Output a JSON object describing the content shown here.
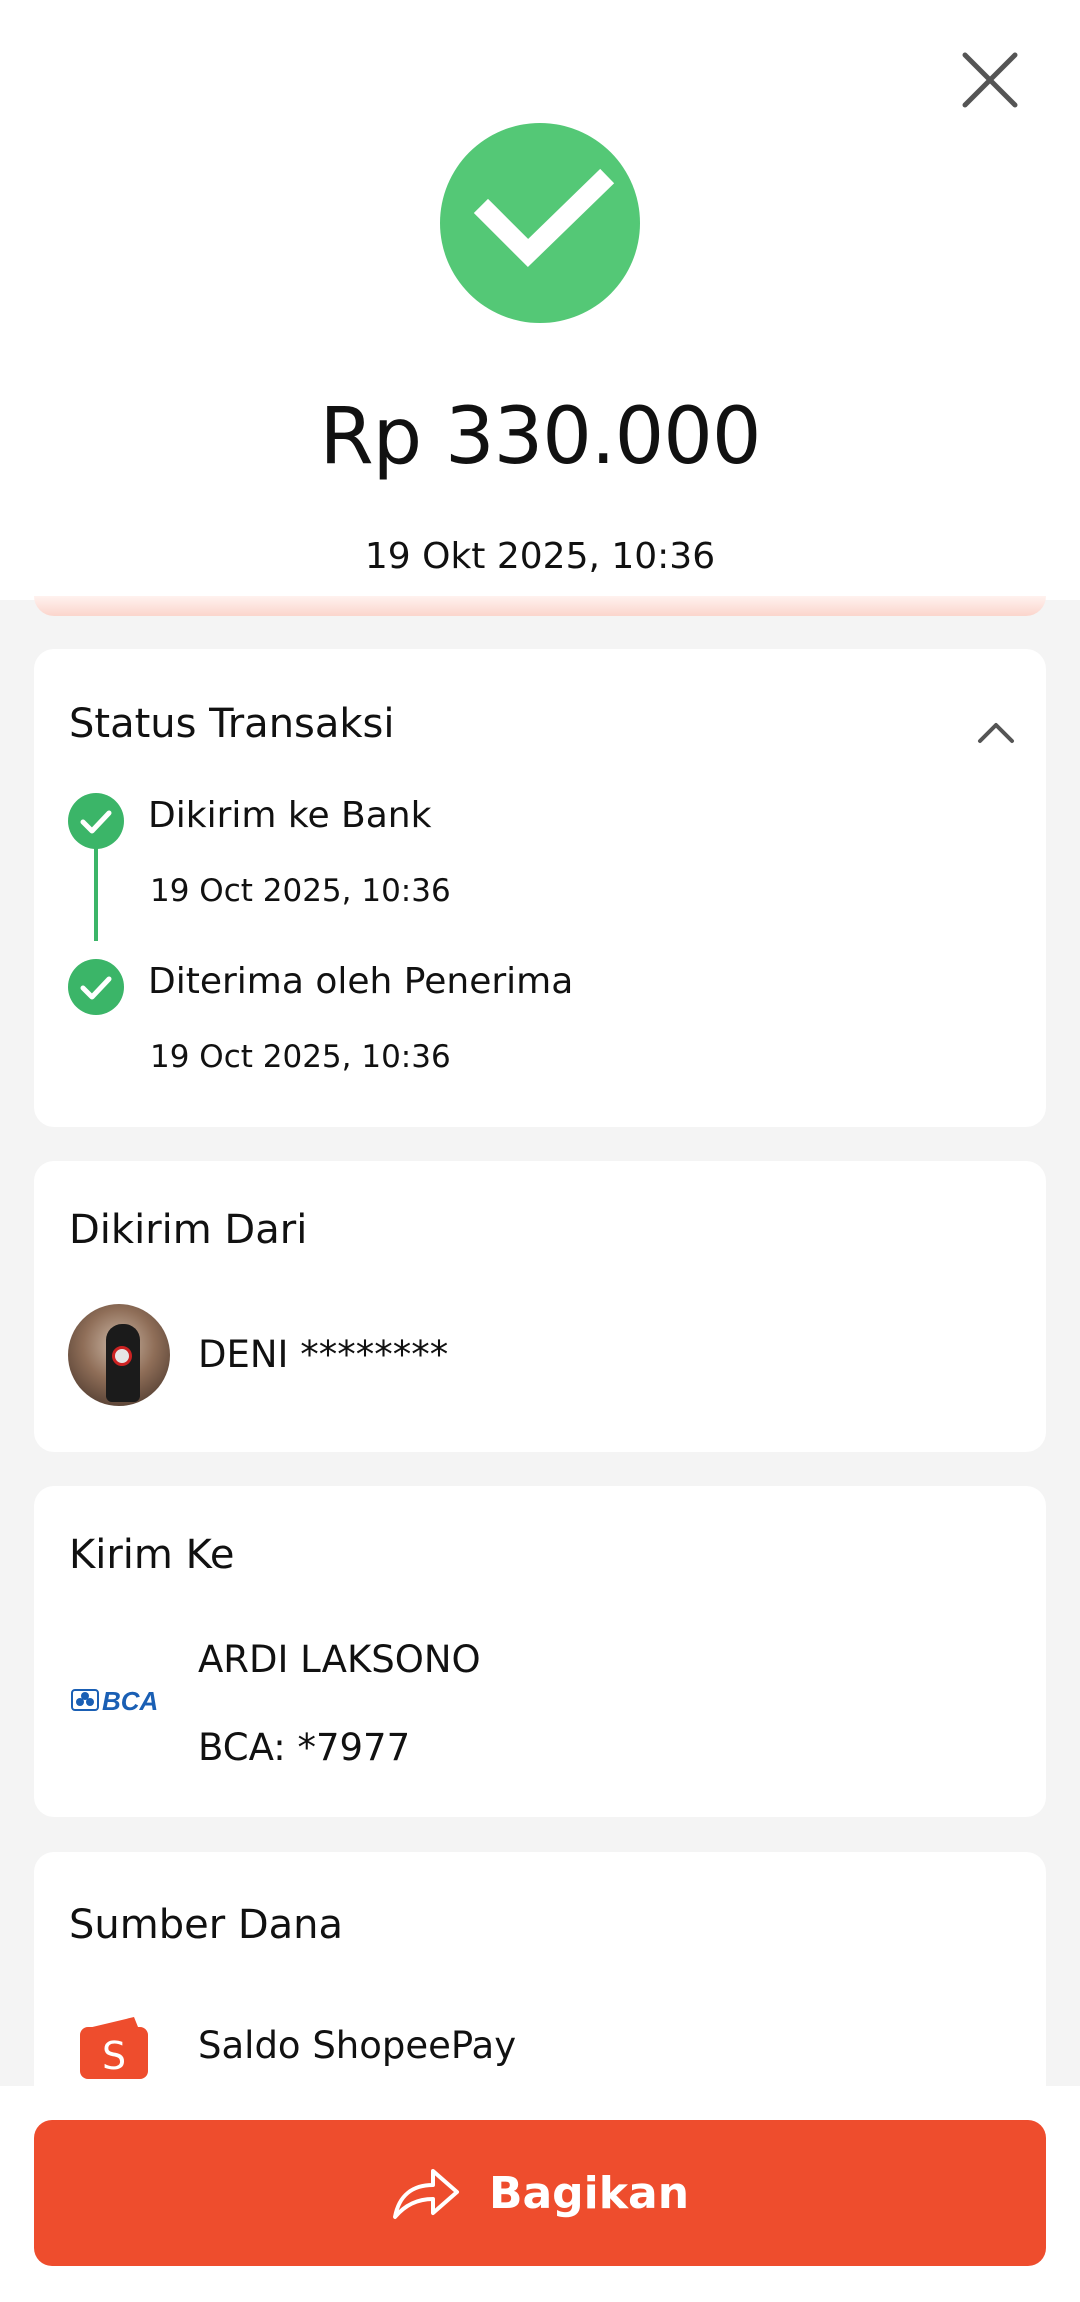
{
  "header": {
    "amount": "Rp 330.000",
    "datetime": "19 Okt 2025, 10:36",
    "close_icon": "close-icon",
    "success_icon": "check-circle-icon",
    "success_color": "#54c876"
  },
  "status": {
    "title": "Status Transaksi",
    "toggle_icon": "chevron-up-icon",
    "steps": [
      {
        "label": "Dikirim ke Bank",
        "time": "19 Oct 2025, 10:36"
      },
      {
        "label": "Diterima oleh Penerima",
        "time": "19 Oct 2025, 10:36"
      }
    ],
    "step_color": "#3bb568"
  },
  "sender": {
    "title": "Dikirim Dari",
    "name": "DENI ********"
  },
  "recipient": {
    "title": "Kirim Ke",
    "name": "ARDI LAKSONO",
    "account": "BCA: *7977",
    "bank_logo": "BCA"
  },
  "source": {
    "title": "Sumber Dana",
    "name": "Saldo ShopeePay",
    "icon": "shopeepay-wallet-icon"
  },
  "footer": {
    "share_label": "Bagikan",
    "share_icon": "share-arrow-icon",
    "accent": "#ee4d2d"
  }
}
